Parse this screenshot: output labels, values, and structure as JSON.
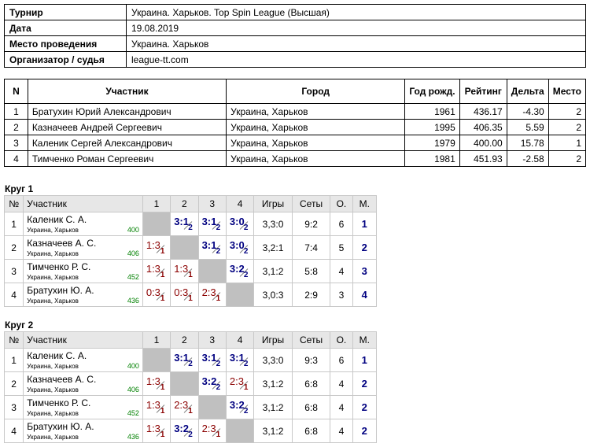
{
  "info": [
    {
      "label": "Турнир",
      "value": "Украина. Харьков. Top Spin League (Высшая)"
    },
    {
      "label": "Дата",
      "value": "19.08.2019"
    },
    {
      "label": "Место проведения",
      "value": "Украина. Харьков"
    },
    {
      "label": "Организатор / судья",
      "value": "league-tt.com"
    }
  ],
  "participants": {
    "headers": [
      "N",
      "Участник",
      "Город",
      "Год рожд.",
      "Рейтинг",
      "Дельта",
      "Место"
    ],
    "rows": [
      [
        "1",
        "Братухин Юрий Александрович",
        "Украина, Харьков",
        "1961",
        "436.17",
        "-4.30",
        "2"
      ],
      [
        "2",
        "Казначеев Андрей Сергеевич",
        "Украина, Харьков",
        "1995",
        "406.35",
        "5.59",
        "2"
      ],
      [
        "3",
        "Каленик Сергей Александрович",
        "Украина, Харьков",
        "1979",
        "400.00",
        "15.78",
        "1"
      ],
      [
        "4",
        "Тимченко Роман Сергеевич",
        "Украина, Харьков",
        "1981",
        "451.93",
        "-2.58",
        "2"
      ]
    ]
  },
  "rounds": [
    {
      "title": "Круг 1",
      "headers": [
        "№",
        "Участник",
        "1",
        "2",
        "3",
        "4",
        "Игры",
        "Сеты",
        "О.",
        "М."
      ],
      "rows": [
        {
          "n": "1",
          "name": "Каленик С. А.",
          "city": "Украина, Харьков",
          "rating": "400",
          "cells": [
            null,
            {
              "s": "3:1",
              "p": "2",
              "w": true
            },
            {
              "s": "3:1",
              "p": "2",
              "w": true
            },
            {
              "s": "3:0",
              "p": "2",
              "w": true
            }
          ],
          "games": "3,3:0",
          "sets": "9:2",
          "o": "6",
          "m": "1"
        },
        {
          "n": "2",
          "name": "Казначеев А. С.",
          "city": "Украина, Харьков",
          "rating": "406",
          "cells": [
            {
              "s": "1:3",
              "p": "1",
              "w": false
            },
            null,
            {
              "s": "3:1",
              "p": "2",
              "w": true
            },
            {
              "s": "3:0",
              "p": "2",
              "w": true
            }
          ],
          "games": "3,2:1",
          "sets": "7:4",
          "o": "5",
          "m": "2"
        },
        {
          "n": "3",
          "name": "Тимченко Р. С.",
          "city": "Украина, Харьков",
          "rating": "452",
          "cells": [
            {
              "s": "1:3",
              "p": "1",
              "w": false
            },
            {
              "s": "1:3",
              "p": "1",
              "w": false
            },
            null,
            {
              "s": "3:2",
              "p": "2",
              "w": true
            }
          ],
          "games": "3,1:2",
          "sets": "5:8",
          "o": "4",
          "m": "3"
        },
        {
          "n": "4",
          "name": "Братухин Ю. А.",
          "city": "Украина, Харьков",
          "rating": "436",
          "cells": [
            {
              "s": "0:3",
              "p": "1",
              "w": false
            },
            {
              "s": "0:3",
              "p": "1",
              "w": false
            },
            {
              "s": "2:3",
              "p": "1",
              "w": false
            },
            null
          ],
          "games": "3,0:3",
          "sets": "2:9",
          "o": "3",
          "m": "4"
        }
      ]
    },
    {
      "title": "Круг 2",
      "headers": [
        "№",
        "Участник",
        "1",
        "2",
        "3",
        "4",
        "Игры",
        "Сеты",
        "О.",
        "М."
      ],
      "rows": [
        {
          "n": "1",
          "name": "Каленик С. А.",
          "city": "Украина, Харьков",
          "rating": "400",
          "cells": [
            null,
            {
              "s": "3:1",
              "p": "2",
              "w": true
            },
            {
              "s": "3:1",
              "p": "2",
              "w": true
            },
            {
              "s": "3:1",
              "p": "2",
              "w": true
            }
          ],
          "games": "3,3:0",
          "sets": "9:3",
          "o": "6",
          "m": "1"
        },
        {
          "n": "2",
          "name": "Казначеев А. С.",
          "city": "Украина, Харьков",
          "rating": "406",
          "cells": [
            {
              "s": "1:3",
              "p": "1",
              "w": false
            },
            null,
            {
              "s": "3:2",
              "p": "2",
              "w": true
            },
            {
              "s": "2:3",
              "p": "1",
              "w": false
            }
          ],
          "games": "3,1:2",
          "sets": "6:8",
          "o": "4",
          "m": "2"
        },
        {
          "n": "3",
          "name": "Тимченко Р. С.",
          "city": "Украина, Харьков",
          "rating": "452",
          "cells": [
            {
              "s": "1:3",
              "p": "1",
              "w": false
            },
            {
              "s": "2:3",
              "p": "1",
              "w": false
            },
            null,
            {
              "s": "3:2",
              "p": "2",
              "w": true
            }
          ],
          "games": "3,1:2",
          "sets": "6:8",
          "o": "4",
          "m": "2"
        },
        {
          "n": "4",
          "name": "Братухин Ю. А.",
          "city": "Украина, Харьков",
          "rating": "436",
          "cells": [
            {
              "s": "1:3",
              "p": "1",
              "w": false
            },
            {
              "s": "3:2",
              "p": "2",
              "w": true
            },
            {
              "s": "2:3",
              "p": "1",
              "w": false
            },
            null
          ],
          "games": "3,1:2",
          "sets": "6:8",
          "o": "4",
          "m": "2"
        }
      ]
    }
  ]
}
